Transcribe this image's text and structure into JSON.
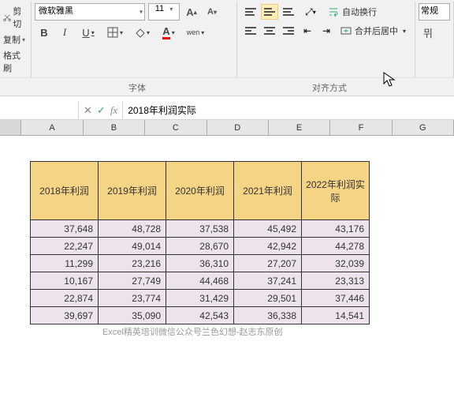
{
  "ribbon": {
    "clipboard": {
      "cut": "剪切",
      "copy": "复制",
      "format_painter": "格式刷"
    },
    "font": {
      "family": "微软雅黑",
      "size": "11",
      "increase": "A⁺",
      "decrease": "A⁻",
      "bold": "B",
      "italic": "I",
      "underline": "U",
      "wen": "wen",
      "label": "字体"
    },
    "alignment": {
      "wrap": "自动换行",
      "merge": "合并后居中",
      "label": "对齐方式"
    },
    "number": {
      "format": "常规"
    }
  },
  "formula_bar": {
    "name_box": "",
    "cancel": "✕",
    "enter": "✓",
    "fx": "fx",
    "value": "2018年利润实际"
  },
  "columns": [
    "A",
    "B",
    "C",
    "D",
    "E",
    "F",
    "G"
  ],
  "table": {
    "headers": [
      "2018年利润",
      "2019年利润",
      "2020年利润",
      "2021年利润",
      "2022年利润实际"
    ],
    "rows": [
      [
        "37,648",
        "48,728",
        "37,538",
        "45,492",
        "43,176"
      ],
      [
        "22,247",
        "49,014",
        "28,670",
        "42,942",
        "44,278"
      ],
      [
        "11,299",
        "23,216",
        "36,310",
        "27,207",
        "32,039"
      ],
      [
        "10,167",
        "27,749",
        "44,468",
        "37,241",
        "23,313"
      ],
      [
        "22,874",
        "23,774",
        "31,429",
        "29,501",
        "37,446"
      ],
      [
        "39,697",
        "35,090",
        "42,543",
        "36,338",
        "14,541"
      ]
    ]
  },
  "footer": "Excel精英培训微信公众号兰色幻想-赵志东原创",
  "chart_data": {
    "type": "table",
    "title": "",
    "columns": [
      "2018年利润",
      "2019年利润",
      "2020年利润",
      "2021年利润",
      "2022年利润实际"
    ],
    "data": [
      [
        37648,
        48728,
        37538,
        45492,
        43176
      ],
      [
        22247,
        49014,
        28670,
        42942,
        44278
      ],
      [
        11299,
        23216,
        36310,
        27207,
        32039
      ],
      [
        10167,
        27749,
        44468,
        37241,
        23313
      ],
      [
        22874,
        23774,
        31429,
        29501,
        37446
      ],
      [
        39697,
        35090,
        42543,
        36338,
        14541
      ]
    ]
  }
}
